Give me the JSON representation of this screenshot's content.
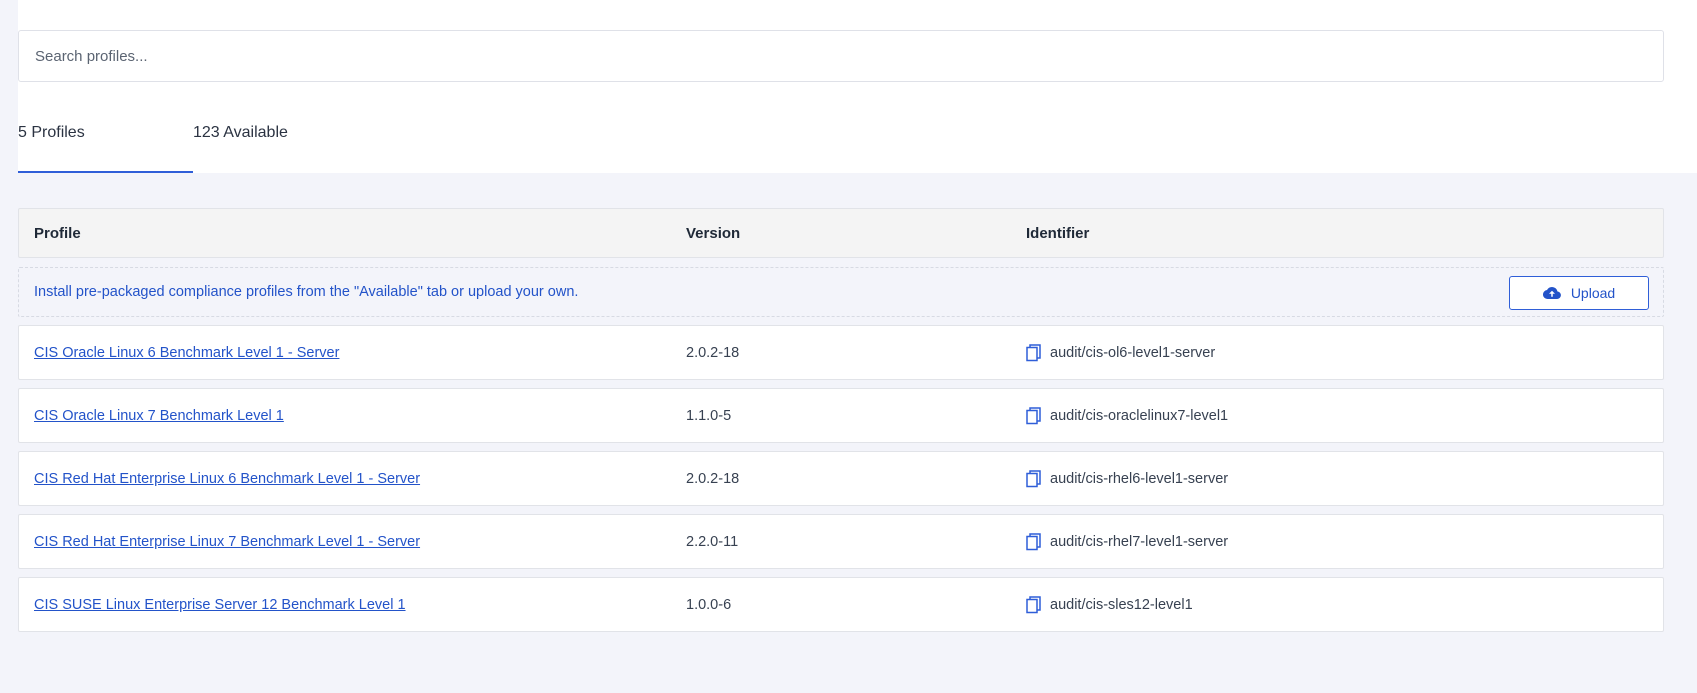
{
  "search": {
    "placeholder": "Search profiles...",
    "value": ""
  },
  "tabs": [
    {
      "label": "5 Profiles",
      "active": true
    },
    {
      "label": "123 Available",
      "active": false
    }
  ],
  "table": {
    "headers": {
      "profile": "Profile",
      "version": "Version",
      "identifier": "Identifier"
    },
    "banner": {
      "text": "Install pre-packaged compliance profiles from the \"Available\" tab or upload your own.",
      "upload_label": "Upload",
      "upload_icon": "cloud-upload-icon"
    },
    "rows": [
      {
        "profile": "CIS Oracle Linux 6 Benchmark Level 1 - Server",
        "version": "2.0.2-18",
        "identifier": "audit/cis-ol6-level1-server"
      },
      {
        "profile": "CIS Oracle Linux 7 Benchmark Level 1",
        "version": "1.1.0-5",
        "identifier": "audit/cis-oraclelinux7-level1"
      },
      {
        "profile": "CIS Red Hat Enterprise Linux 6 Benchmark Level 1 - Server",
        "version": "2.0.2-18",
        "identifier": "audit/cis-rhel6-level1-server"
      },
      {
        "profile": "CIS Red Hat Enterprise Linux 7 Benchmark Level 1 - Server",
        "version": "2.2.0-11",
        "identifier": "audit/cis-rhel7-level1-server"
      },
      {
        "profile": "CIS SUSE Linux Enterprise Server 12 Benchmark Level 1",
        "version": "1.0.0-6",
        "identifier": "audit/cis-sles12-level1"
      }
    ]
  },
  "colors": {
    "accent": "#2f5ed8",
    "link": "#2353c9",
    "page_bg": "#f3f4fa"
  }
}
